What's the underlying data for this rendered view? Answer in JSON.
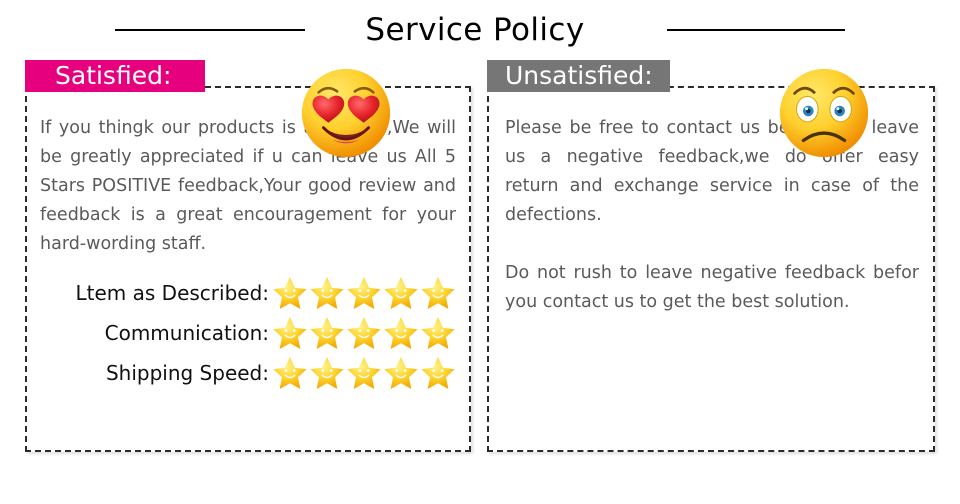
{
  "header": {
    "title": "Service Policy",
    "rule_left": "horizontal-rule",
    "rule_right": "horizontal-rule"
  },
  "colors": {
    "satisfied_badge": "#E6007E",
    "unsatisfied_badge": "#767676",
    "body_text": "#5A5A5A",
    "label_text": "#111111",
    "star": "#FFC107",
    "border": "#2B2B2B",
    "background": "#FFFFFF"
  },
  "left_column": {
    "badge_label": "Satisfied:",
    "emoji": "smiling-face-with-heart-eyes",
    "paragraphs": [
      "If you thingk our products is awesome,We will be greatly appreciated if u can leave us All 5 Stars POSITIVE feedback,Your good review and feedback is a great encouragement for your hard-wording staff."
    ],
    "ratings": [
      {
        "label": "Ltem as Described:",
        "stars": 5,
        "max": 5
      },
      {
        "label": "Communication:",
        "stars": 5,
        "max": 5
      },
      {
        "label": "Shipping Speed:",
        "stars": 5,
        "max": 5
      }
    ]
  },
  "right_column": {
    "badge_label": "Unsatisfied:",
    "emoji": "frowning-face-with-worried-eyes",
    "paragraphs": [
      "Please be free to contact us before you leave us a negative feedback,we do offer easy return and exchange service in case of the defections.",
      "Do not rush to leave negative feedback befor you contact us to get the best solution."
    ]
  }
}
